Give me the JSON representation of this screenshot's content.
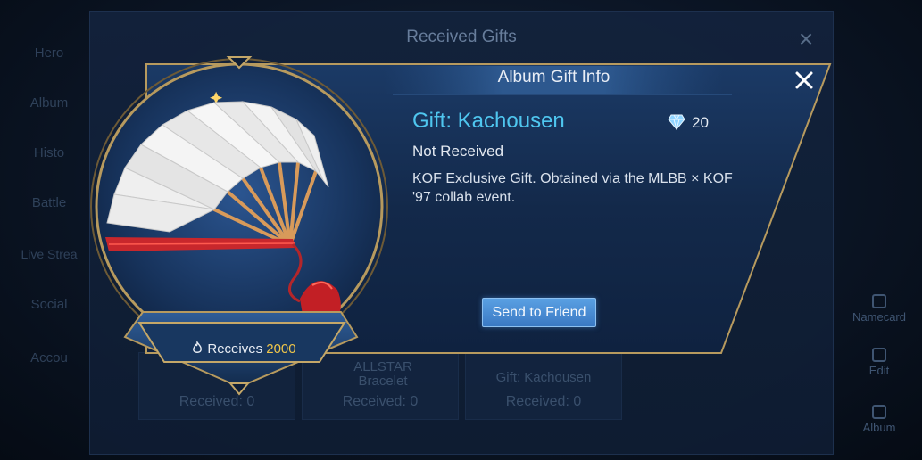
{
  "background": {
    "menu_items": [
      "Hero",
      "Album",
      "Histo",
      "Battle",
      "Live Strea",
      "Social",
      "Accou"
    ],
    "right_items": [
      "Namecard",
      "Edit",
      "Album"
    ]
  },
  "received_gifts": {
    "title": "Received Gifts",
    "tiles": [
      {
        "name": "",
        "received": "Received: 0"
      },
      {
        "name": "ALLSTAR Bracelet",
        "received": "Received: 0"
      },
      {
        "name": "Gift: Kachousen",
        "received": "Received: 0"
      }
    ]
  },
  "dialog": {
    "title": "Album Gift Info",
    "gift_name": "Gift: Kachousen",
    "price": "20",
    "status": "Not Received",
    "description": "KOF Exclusive Gift. Obtained via the MLBB × KOF '97 collab event.",
    "send_button": "Send to Friend"
  },
  "emblem": {
    "receives_label": "Receives",
    "receives_count": "2000",
    "icon": "fan-gift-icon"
  },
  "colors": {
    "accent_gift_name": "#4fc6ef",
    "count_gold": "#f0c64a",
    "button_blue": "#3a79c4",
    "frame_gold": "#b79a5e"
  }
}
